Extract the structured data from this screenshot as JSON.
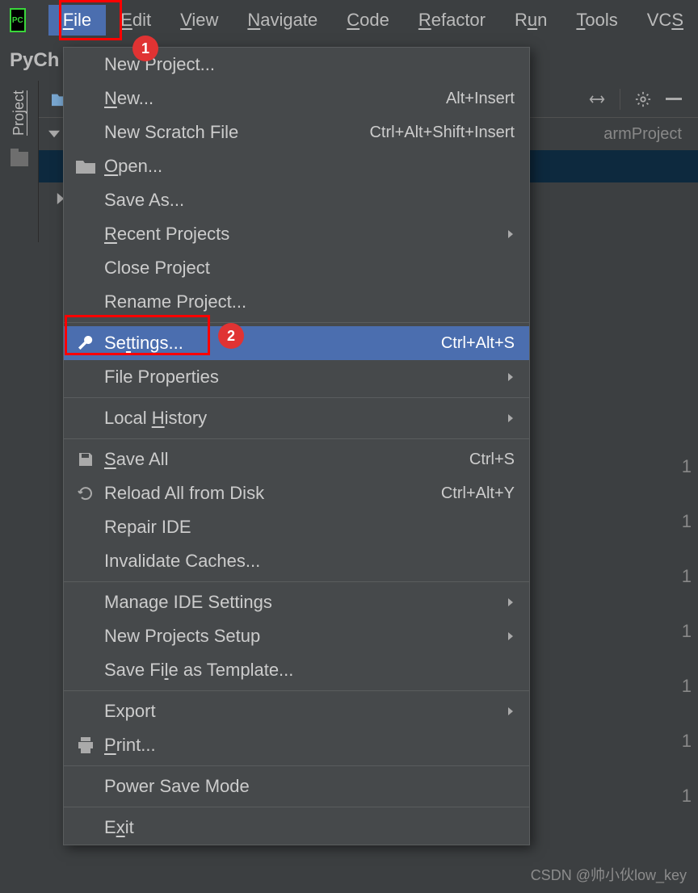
{
  "menubar": {
    "items": [
      {
        "label": "File",
        "mn": "F",
        "active": true
      },
      {
        "label": "Edit",
        "mn": "E"
      },
      {
        "label": "View",
        "mn": "V"
      },
      {
        "label": "Navigate",
        "mn": "N"
      },
      {
        "label": "Code",
        "mn": "C"
      },
      {
        "label": "Refactor",
        "mn": "R"
      },
      {
        "label": "Run",
        "mn": "u",
        "full": "Run"
      },
      {
        "label": "Tools",
        "mn": "T"
      },
      {
        "label": "VCS",
        "mn": "S",
        "full": "VCS"
      }
    ]
  },
  "app_title_fragment": "PyCh",
  "sidebar": {
    "label": "Project"
  },
  "project_tree": {
    "visible_fragment": "armProject"
  },
  "dropdown": {
    "groups": [
      [
        {
          "label": "New Project...",
          "icon": "",
          "shortcut": "",
          "mn": ""
        },
        {
          "label": "New...",
          "icon": "",
          "shortcut": "Alt+Insert",
          "mn": "N"
        },
        {
          "label": "New Scratch File",
          "icon": "",
          "shortcut": "Ctrl+Alt+Shift+Insert",
          "mn": ""
        },
        {
          "label": "Open...",
          "icon": "folder",
          "shortcut": "",
          "mn": "O"
        },
        {
          "label": "Save As...",
          "icon": "",
          "shortcut": "",
          "mn": ""
        },
        {
          "label": "Recent Projects",
          "icon": "",
          "shortcut": "",
          "submenu": true,
          "mn": "R"
        },
        {
          "label": "Close Project",
          "icon": "",
          "shortcut": "",
          "mn": ""
        },
        {
          "label": "Rename Project...",
          "icon": "",
          "shortcut": "",
          "mn": ""
        }
      ],
      [
        {
          "label": "Settings...",
          "icon": "wrench",
          "shortcut": "Ctrl+Alt+S",
          "hover": true,
          "mn": "t"
        },
        {
          "label": "File Properties",
          "icon": "",
          "shortcut": "",
          "submenu": true,
          "mn": ""
        }
      ],
      [
        {
          "label": "Local History",
          "icon": "",
          "shortcut": "",
          "submenu": true,
          "mn": "H"
        }
      ],
      [
        {
          "label": "Save All",
          "icon": "save",
          "shortcut": "Ctrl+S",
          "mn": "S"
        },
        {
          "label": "Reload All from Disk",
          "icon": "reload",
          "shortcut": "Ctrl+Alt+Y",
          "mn": ""
        },
        {
          "label": "Repair IDE",
          "icon": "",
          "shortcut": "",
          "mn": ""
        },
        {
          "label": "Invalidate Caches...",
          "icon": "",
          "shortcut": "",
          "mn": ""
        }
      ],
      [
        {
          "label": "Manage IDE Settings",
          "icon": "",
          "shortcut": "",
          "submenu": true,
          "mn": ""
        },
        {
          "label": "New Projects Setup",
          "icon": "",
          "shortcut": "",
          "submenu": true,
          "mn": ""
        },
        {
          "label": "Save File as Template...",
          "icon": "",
          "shortcut": "",
          "mn": "l"
        }
      ],
      [
        {
          "label": "Export",
          "icon": "",
          "shortcut": "",
          "submenu": true,
          "mn": ""
        },
        {
          "label": "Print...",
          "icon": "print",
          "shortcut": "",
          "mn": "P"
        }
      ],
      [
        {
          "label": "Power Save Mode",
          "icon": "",
          "shortcut": "",
          "mn": ""
        }
      ],
      [
        {
          "label": "Exit",
          "icon": "",
          "shortcut": "",
          "mn": "x"
        }
      ]
    ]
  },
  "annotations": {
    "box1": {
      "num": "1"
    },
    "box2": {
      "num": "2"
    }
  },
  "gutter_nums": [
    "1",
    "1",
    "1",
    "1",
    "1",
    "1",
    "1"
  ],
  "watermark": "CSDN @帅小伙low_key"
}
